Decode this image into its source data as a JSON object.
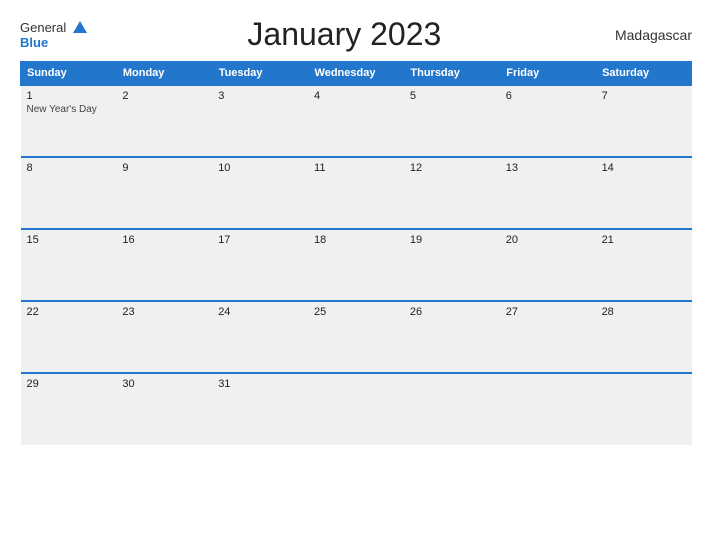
{
  "header": {
    "logo_general": "General",
    "logo_blue": "Blue",
    "title": "January 2023",
    "country": "Madagascar"
  },
  "days": [
    "Sunday",
    "Monday",
    "Tuesday",
    "Wednesday",
    "Thursday",
    "Friday",
    "Saturday"
  ],
  "weeks": [
    [
      {
        "date": "1",
        "event": "New Year's Day"
      },
      {
        "date": "2",
        "event": ""
      },
      {
        "date": "3",
        "event": ""
      },
      {
        "date": "4",
        "event": ""
      },
      {
        "date": "5",
        "event": ""
      },
      {
        "date": "6",
        "event": ""
      },
      {
        "date": "7",
        "event": ""
      }
    ],
    [
      {
        "date": "8",
        "event": ""
      },
      {
        "date": "9",
        "event": ""
      },
      {
        "date": "10",
        "event": ""
      },
      {
        "date": "11",
        "event": ""
      },
      {
        "date": "12",
        "event": ""
      },
      {
        "date": "13",
        "event": ""
      },
      {
        "date": "14",
        "event": ""
      }
    ],
    [
      {
        "date": "15",
        "event": ""
      },
      {
        "date": "16",
        "event": ""
      },
      {
        "date": "17",
        "event": ""
      },
      {
        "date": "18",
        "event": ""
      },
      {
        "date": "19",
        "event": ""
      },
      {
        "date": "20",
        "event": ""
      },
      {
        "date": "21",
        "event": ""
      }
    ],
    [
      {
        "date": "22",
        "event": ""
      },
      {
        "date": "23",
        "event": ""
      },
      {
        "date": "24",
        "event": ""
      },
      {
        "date": "25",
        "event": ""
      },
      {
        "date": "26",
        "event": ""
      },
      {
        "date": "27",
        "event": ""
      },
      {
        "date": "28",
        "event": ""
      }
    ],
    [
      {
        "date": "29",
        "event": ""
      },
      {
        "date": "30",
        "event": ""
      },
      {
        "date": "31",
        "event": ""
      },
      {
        "date": "",
        "event": ""
      },
      {
        "date": "",
        "event": ""
      },
      {
        "date": "",
        "event": ""
      },
      {
        "date": "",
        "event": ""
      }
    ]
  ]
}
